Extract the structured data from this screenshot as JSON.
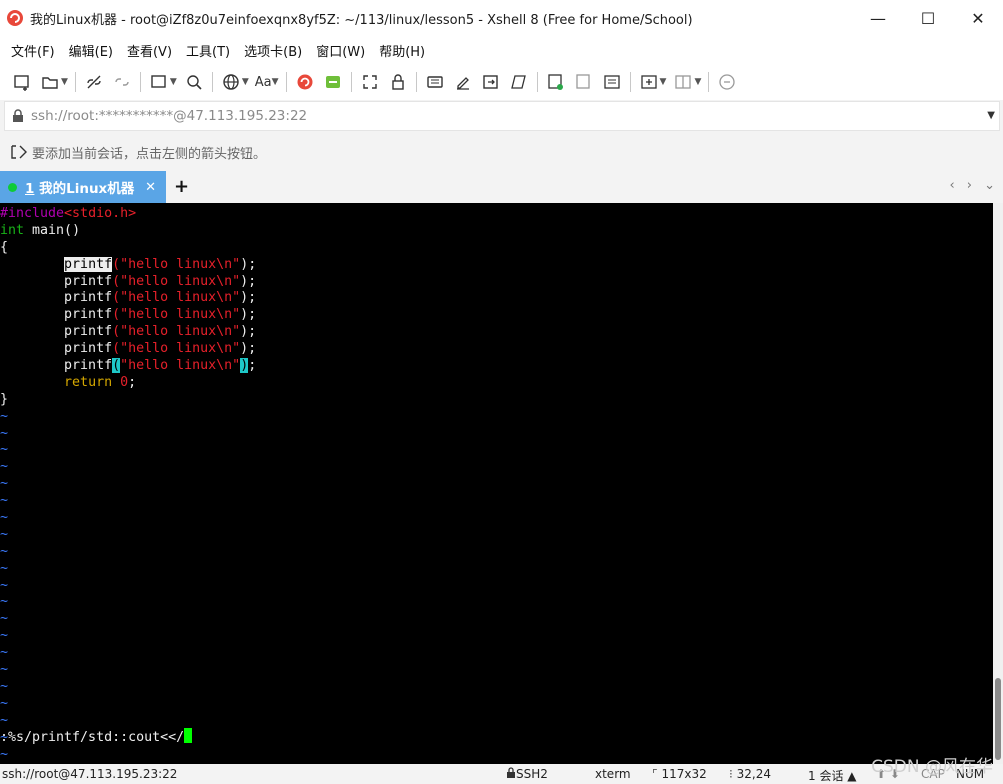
{
  "window": {
    "title": "我的Linux机器 - root@iZf8z0u7einfoexqnx8yf5Z: ~/113/linux/lesson5 - Xshell 8 (Free for Home/School)",
    "controls": {
      "minimize": "—",
      "maximize": "☐",
      "close": "✕"
    }
  },
  "menu": {
    "items": [
      "文件(F)",
      "编辑(E)",
      "查看(V)",
      "工具(T)",
      "选项卡(B)",
      "窗口(W)",
      "帮助(H)"
    ]
  },
  "toolbar": {
    "font_label": "Aa"
  },
  "address": {
    "value": "ssh://root:***********@47.113.195.23:22"
  },
  "hint": {
    "text": "要添加当前会话，点击左侧的箭头按钮。"
  },
  "tabs": [
    {
      "number": "1",
      "label": "我的Linux机器",
      "close": "✕",
      "status_color": "#0ecb38"
    }
  ],
  "tabbar": {
    "add": "+",
    "nav": "‹ › ⌄"
  },
  "terminal": {
    "lines": [
      {
        "segments": [
          {
            "cls": "pp",
            "text": "#include"
          },
          {
            "cls": "st",
            "text": "<stdio.h>"
          }
        ]
      },
      {
        "segments": [
          {
            "cls": "ty",
            "text": "int"
          },
          {
            "cls": "df",
            "text": " main()"
          }
        ]
      },
      {
        "segments": [
          {
            "cls": "df",
            "text": "{"
          }
        ]
      },
      {
        "segments": [
          {
            "cls": "df",
            "text": "        "
          },
          {
            "cls": "df cur-word",
            "text": "printf"
          },
          {
            "cls": "st",
            "text": "(\"hello linux\\n\""
          },
          {
            "cls": "df",
            "text": ");"
          }
        ]
      },
      {
        "segments": [
          {
            "cls": "df",
            "text": "        printf"
          },
          {
            "cls": "st",
            "text": "(\"hello linux\\n\""
          },
          {
            "cls": "df",
            "text": ");"
          }
        ]
      },
      {
        "segments": [
          {
            "cls": "df",
            "text": "        printf"
          },
          {
            "cls": "st",
            "text": "(\"hello linux\\n\""
          },
          {
            "cls": "df",
            "text": ");"
          }
        ]
      },
      {
        "segments": [
          {
            "cls": "df",
            "text": "        printf"
          },
          {
            "cls": "st",
            "text": "(\"hello linux\\n\""
          },
          {
            "cls": "df",
            "text": ");"
          }
        ]
      },
      {
        "segments": [
          {
            "cls": "df",
            "text": "        printf"
          },
          {
            "cls": "st",
            "text": "(\"hello linux\\n\""
          },
          {
            "cls": "df",
            "text": ");"
          }
        ]
      },
      {
        "segments": [
          {
            "cls": "df",
            "text": "        printf"
          },
          {
            "cls": "st",
            "text": "(\"hello linux\\n\""
          },
          {
            "cls": "df",
            "text": ");"
          }
        ]
      },
      {
        "segments": [
          {
            "cls": "df",
            "text": "        printf"
          },
          {
            "cls": "cur-paren",
            "text": "("
          },
          {
            "cls": "st",
            "text": "\"hello linux\\n\""
          },
          {
            "cls": "cur-paren",
            "text": ")"
          },
          {
            "cls": "df",
            "text": ";"
          }
        ]
      },
      {
        "segments": [
          {
            "cls": "df",
            "text": "        "
          },
          {
            "cls": "kw",
            "text": "return"
          },
          {
            "cls": "df",
            "text": " "
          },
          {
            "cls": "st",
            "text": "0"
          },
          {
            "cls": "df",
            "text": ";"
          }
        ]
      },
      {
        "segments": [
          {
            "cls": "df",
            "text": "}"
          }
        ]
      },
      {
        "segments": [
          {
            "cls": "tl",
            "text": "~"
          }
        ]
      },
      {
        "segments": [
          {
            "cls": "tl",
            "text": "~"
          }
        ]
      },
      {
        "segments": [
          {
            "cls": "tl",
            "text": "~"
          }
        ]
      },
      {
        "segments": [
          {
            "cls": "tl",
            "text": "~"
          }
        ]
      },
      {
        "segments": [
          {
            "cls": "tl",
            "text": "~"
          }
        ]
      },
      {
        "segments": [
          {
            "cls": "tl",
            "text": "~"
          }
        ]
      },
      {
        "segments": [
          {
            "cls": "tl",
            "text": "~"
          }
        ]
      },
      {
        "segments": [
          {
            "cls": "tl",
            "text": "~"
          }
        ]
      },
      {
        "segments": [
          {
            "cls": "tl",
            "text": "~"
          }
        ]
      },
      {
        "segments": [
          {
            "cls": "tl",
            "text": "~"
          }
        ]
      },
      {
        "segments": [
          {
            "cls": "tl",
            "text": "~"
          }
        ]
      },
      {
        "segments": [
          {
            "cls": "tl",
            "text": "~"
          }
        ]
      },
      {
        "segments": [
          {
            "cls": "tl",
            "text": "~"
          }
        ]
      },
      {
        "segments": [
          {
            "cls": "tl",
            "text": "~"
          }
        ]
      },
      {
        "segments": [
          {
            "cls": "tl",
            "text": "~"
          }
        ]
      },
      {
        "segments": [
          {
            "cls": "tl",
            "text": "~"
          }
        ]
      },
      {
        "segments": [
          {
            "cls": "tl",
            "text": "~"
          }
        ]
      },
      {
        "segments": [
          {
            "cls": "tl",
            "text": "~"
          }
        ]
      },
      {
        "segments": [
          {
            "cls": "tl",
            "text": "~"
          }
        ]
      },
      {
        "segments": [
          {
            "cls": "tl",
            "text": "~"
          }
        ]
      },
      {
        "segments": [
          {
            "cls": "tl",
            "text": "~"
          }
        ]
      },
      {
        "segments": [
          {
            "cls": "tl",
            "text": "~"
          }
        ]
      }
    ],
    "command": ":%s/printf/std::cout<</"
  },
  "status": {
    "connection": "ssh://root@47.113.195.23:22",
    "protocol": "SSH2",
    "term": "xterm",
    "size": "117x32",
    "position": "32,24",
    "sessions": "1 会话",
    "cap": "CAP",
    "num": "NUM"
  },
  "watermark": "CSDN @风在华"
}
